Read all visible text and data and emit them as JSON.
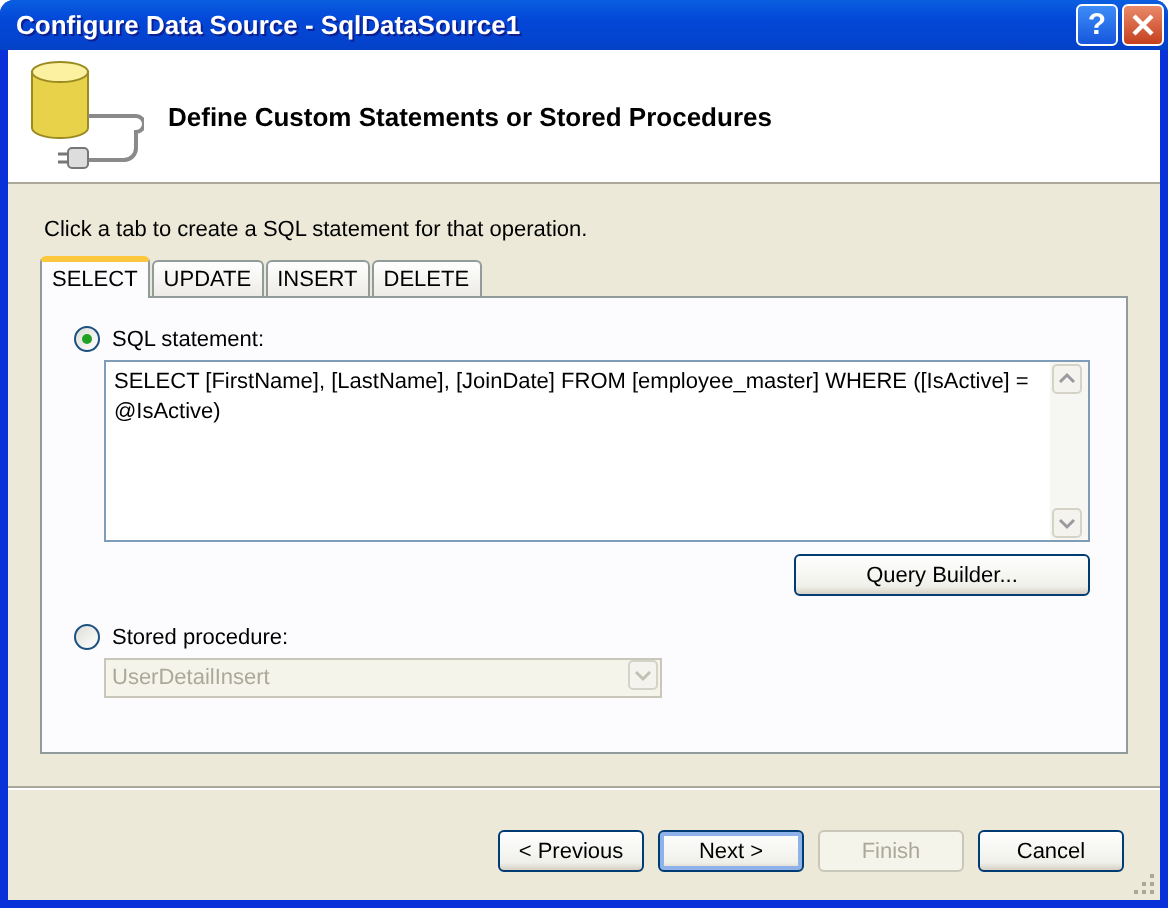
{
  "window": {
    "title": "Configure Data Source - SqlDataSource1",
    "help_label": "?"
  },
  "header": {
    "title": "Define Custom Statements or Stored Procedures"
  },
  "instruction": "Click a tab to create a SQL statement for that operation.",
  "tabs": [
    {
      "label": "SELECT",
      "selected": true
    },
    {
      "label": "UPDATE",
      "selected": false
    },
    {
      "label": "INSERT",
      "selected": false
    },
    {
      "label": "DELETE",
      "selected": false
    }
  ],
  "options": [
    {
      "kind": "text",
      "label": "SQL statement:",
      "selected": true,
      "value": "SELECT [FirstName], [LastName], [JoinDate] FROM [employee_master] WHERE ([IsActive] = @IsActive)",
      "disabled": false
    },
    {
      "kind": "dropdown",
      "label": "Stored procedure:",
      "selected": false,
      "value": "UserDetailInsert",
      "disabled": true
    }
  ],
  "query_builder_button": "Query Builder...",
  "buttons": [
    {
      "label": "< Previous",
      "disabled": false,
      "default": false
    },
    {
      "label": "Next >",
      "disabled": false,
      "default": true
    },
    {
      "label": "Finish",
      "disabled": true,
      "default": false
    },
    {
      "label": "Cancel",
      "disabled": false,
      "default": false
    }
  ]
}
